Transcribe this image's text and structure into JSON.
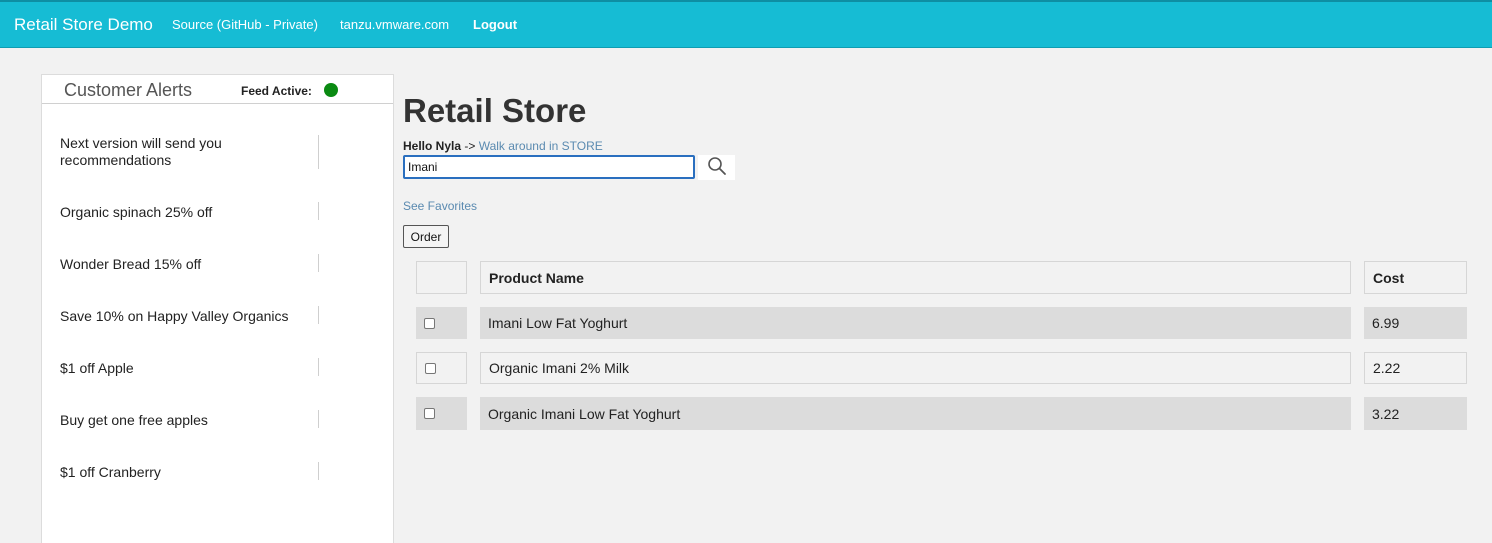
{
  "navbar": {
    "brand": "Retail Store Demo",
    "links": [
      "Source (GitHub - Private)",
      "tanzu.vmware.com",
      "Logout"
    ]
  },
  "alerts": {
    "title": "Customer Alerts",
    "feed_label": "Feed Active:",
    "feed_status_color": "#0a8a12",
    "items": [
      "Next version will send you recommendations",
      "Organic spinach 25% off",
      "Wonder Bread 15% off",
      "Save 10% on Happy Valley Organics",
      "$1 off Apple",
      "Buy get one free apples",
      "$1 off Cranberry"
    ]
  },
  "main": {
    "title": "Retail Store",
    "greeting_name": "Hello Nyla",
    "greeting_arrow": " -> ",
    "walk_link": "Walk around in STORE",
    "search_value": "Imani",
    "search_icon": "search-icon",
    "see_favorites": "See Favorites",
    "order_label": "Order"
  },
  "table": {
    "headers": [
      "",
      "Product Name",
      "Cost"
    ],
    "rows": [
      {
        "name": "Imani Low Fat Yoghurt",
        "cost": "6.99"
      },
      {
        "name": "Organic Imani 2% Milk",
        "cost": "2.22"
      },
      {
        "name": "Organic Imani Low Fat Yoghurt",
        "cost": "3.22"
      }
    ]
  },
  "colors": {
    "navbar": "#16bcd4",
    "link": "#5a8ab0"
  }
}
